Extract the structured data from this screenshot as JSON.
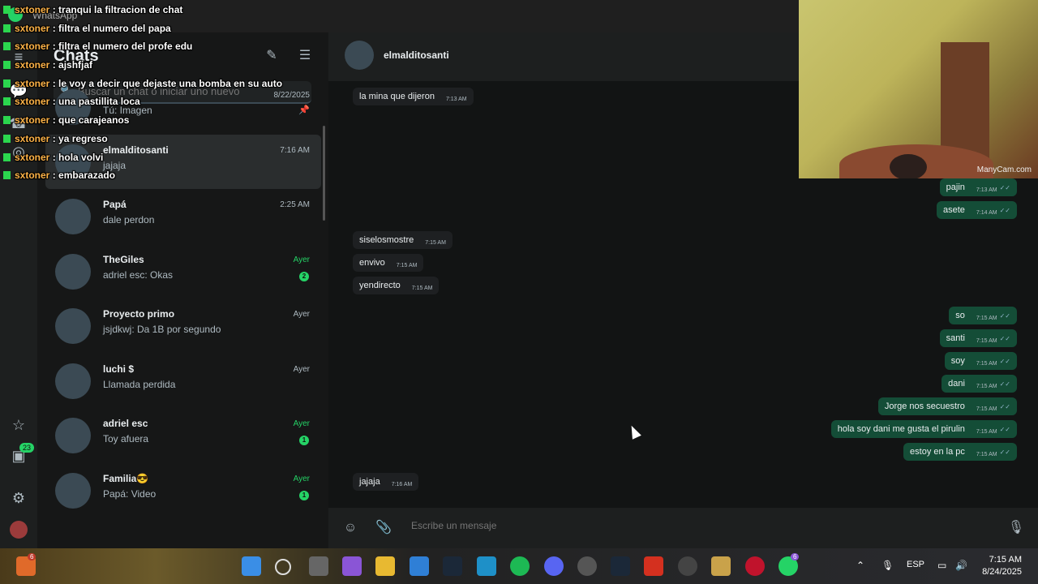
{
  "window": {
    "app_name": "WhatsApp"
  },
  "sidebar": {
    "chats_title": "Chats",
    "search_placeholder": "Buscar un chat o iniciar uno nuevo",
    "rail_badge": "23"
  },
  "chats": [
    {
      "name": "",
      "preview": "Tú: Imagen",
      "time": "8/22/2025",
      "pinned": true
    },
    {
      "name": "elmalditosanti",
      "preview": "jajaja",
      "time": "7:16 AM",
      "active": true
    },
    {
      "name": "Papá",
      "preview": "dale perdon",
      "time": "2:25 AM"
    },
    {
      "name": "TheGiles",
      "preview": "adriel esc: Okas",
      "time": "Ayer",
      "unread": "2"
    },
    {
      "name": "Proyecto primo",
      "preview": "jsjdkwj: Da 1B por segundo",
      "time": "Ayer"
    },
    {
      "name": "luchi $",
      "preview": "Llamada perdida",
      "time": "Ayer"
    },
    {
      "name": "adriel esc",
      "preview": "Toy afuera",
      "time": "Ayer",
      "unread": "1"
    },
    {
      "name": "Familia😎",
      "preview": "Papá: Video",
      "time": "Ayer",
      "unread": "1"
    }
  ],
  "conversation": {
    "contact_name": "elmalditosanti",
    "composer_placeholder": "Escribe un mensaje",
    "messages": [
      {
        "dir": "in",
        "text": "la mina que dijeron",
        "time": "7:13 AM"
      },
      {
        "dir": "out",
        "text": "pajin",
        "time": "7:13 AM"
      },
      {
        "dir": "out",
        "text": "asete",
        "time": "7:14 AM"
      },
      {
        "dir": "in",
        "text": "siselosmostre",
        "time": "7:15 AM"
      },
      {
        "dir": "in",
        "text": "envivo",
        "time": "7:15 AM"
      },
      {
        "dir": "in",
        "text": "yendirecto",
        "time": "7:15 AM"
      },
      {
        "dir": "out",
        "text": "so",
        "time": "7:15 AM"
      },
      {
        "dir": "out",
        "text": "santi",
        "time": "7:15 AM"
      },
      {
        "dir": "out",
        "text": "soy",
        "time": "7:15 AM"
      },
      {
        "dir": "out",
        "text": "dani",
        "time": "7:15 AM"
      },
      {
        "dir": "out",
        "text": "Jorge nos secuestro",
        "time": "7:15 AM"
      },
      {
        "dir": "out",
        "text": "hola soy dani me gusta el pirulin",
        "time": "7:15 AM"
      },
      {
        "dir": "out",
        "text": "estoy en la pc",
        "time": "7:15 AM"
      },
      {
        "dir": "in",
        "text": "jajaja",
        "time": "7:16 AM"
      }
    ]
  },
  "webcam": {
    "watermark": "ManyCam.com"
  },
  "stream_chat": [
    {
      "user": "sxtoner",
      "text": "tranqui la filtracion de chat"
    },
    {
      "user": "sxtoner",
      "text": "filtra el numero del papa"
    },
    {
      "user": "sxtoner",
      "text": "filtra el numero del profe edu"
    },
    {
      "user": "sxtoner",
      "text": "ajshfjaf"
    },
    {
      "user": "sxtoner",
      "text": "le voy a decir que dejaste una bomba en su auto"
    },
    {
      "user": "sxtoner",
      "text": "una pastillita loca"
    },
    {
      "user": "sxtoner",
      "text": "que carajeanos"
    },
    {
      "user": "sxtoner",
      "text": "ya regreso"
    },
    {
      "user": "sxtoner",
      "text": "hola volvi"
    },
    {
      "user": "sxtoner",
      "text": "embarazado"
    }
  ],
  "taskbar": {
    "language": "ESP",
    "time": "7:15 AM",
    "date": "8/24/2025",
    "left_badge": "6",
    "whatsapp_badge": "6"
  },
  "icons": [
    "whatsapp-icon",
    "menu-icon",
    "new-chat-icon",
    "filter-icon",
    "search-icon",
    "pin-icon",
    "star-icon",
    "archive-icon",
    "settings-icon",
    "emoji-icon",
    "attach-icon",
    "mic-icon",
    "windows-start-icon",
    "volume-icon",
    "network-icon"
  ]
}
